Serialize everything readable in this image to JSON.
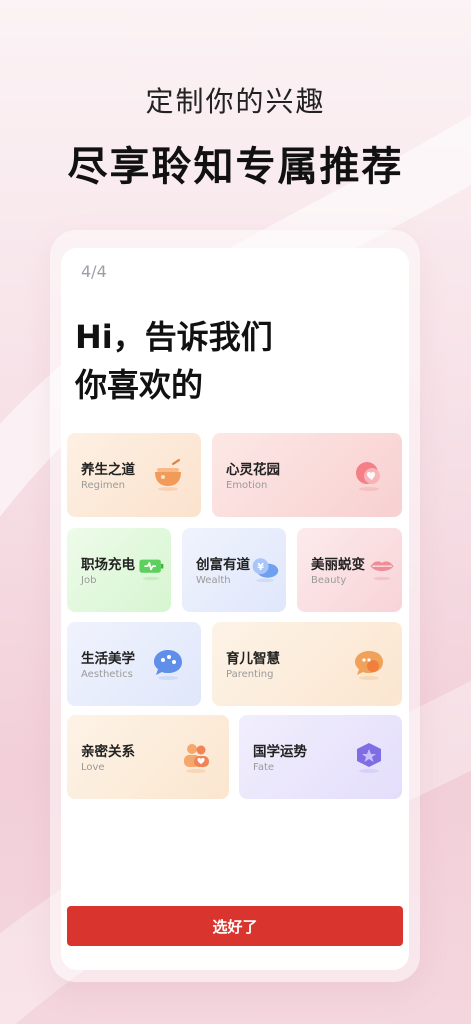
{
  "headline": {
    "subtitle": "定制你的兴趣",
    "title": "尽享聆知专属推荐"
  },
  "screen": {
    "step": "4/4",
    "greeting_line1": "Hi，告诉我们",
    "greeting_line2": "你喜欢的",
    "interests": [
      {
        "label": "养生之道",
        "sub": "Regimen"
      },
      {
        "label": "心灵花园",
        "sub": "Emotion"
      },
      {
        "label": "职场充电",
        "sub": "Job"
      },
      {
        "label": "创富有道",
        "sub": "Wealth"
      },
      {
        "label": "美丽蜕变",
        "sub": "Beauty"
      },
      {
        "label": "生活美学",
        "sub": "Aesthetics"
      },
      {
        "label": "育儿智慧",
        "sub": "Parenting"
      },
      {
        "label": "亲密关系",
        "sub": "Love"
      },
      {
        "label": "国学运势",
        "sub": "Fate"
      }
    ],
    "submit_label": "选好了"
  },
  "colors": {
    "accent": "#d9352e",
    "regimen_bg": "#fbe8d6",
    "emotion_bg": "#f9d9d9",
    "job_bg": "#dff7d9",
    "wealth_bg": "#e5ebfb",
    "beauty_bg": "#f9d9dc",
    "aesthetics_bg": "#e7ecfb",
    "parenting_bg": "#fdeedd",
    "love_bg": "#fdeedd",
    "fate_bg": "#ece8fb"
  },
  "icons": {
    "regimen": "soup-bowl-icon",
    "emotion": "heart-cushion-icon",
    "job": "battery-charge-icon",
    "wealth": "coin-cloud-icon",
    "beauty": "lips-icon",
    "aesthetics": "palette-bubble-icon",
    "parenting": "baby-bubble-icon",
    "love": "couple-icon",
    "fate": "gem-star-icon"
  }
}
